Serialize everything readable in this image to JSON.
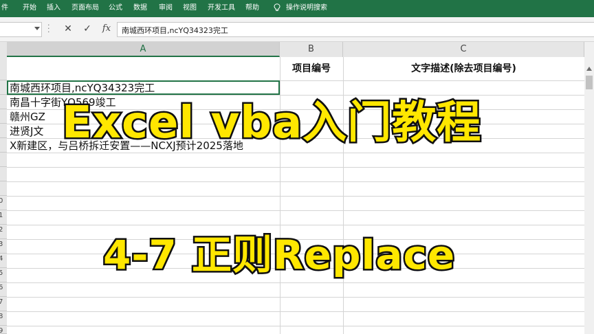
{
  "ribbon": {
    "tabs": [
      "件",
      "开始",
      "插入",
      "页面布局",
      "公式",
      "数据",
      "审阅",
      "视图",
      "开发工具",
      "帮助"
    ],
    "tell_me": "操作说明搜索",
    "bulb_icon": "lightbulb-icon",
    "color": "#217346"
  },
  "formula_bar": {
    "name_box": "",
    "cancel_icon": "✕",
    "enter_icon": "✓",
    "fx_label": "fx",
    "content": "南城西环项目,ncYQ34323完工"
  },
  "columns": [
    "A",
    "B",
    "C"
  ],
  "row_labels": [
    "",
    "",
    "",
    "",
    "",
    "",
    "",
    "",
    "",
    "0",
    "1",
    "2",
    "3",
    "4",
    "5",
    "6",
    "7",
    "8",
    "9"
  ],
  "table": {
    "headers": [
      "",
      "项目编号",
      "文字描述(除去项目编号)"
    ],
    "rows": [
      [
        "南城西环项目,ncYQ34323完工",
        "",
        ""
      ],
      [
        "南昌十字街YQ569竣工",
        "",
        ""
      ],
      [
        "赣州GZ",
        "",
        ""
      ],
      [
        "进贤J文",
        "",
        ""
      ],
      [
        "X新建区，与吕桥拆迁安置——NCXJ预计2025落地",
        "",
        ""
      ]
    ]
  },
  "overlay": {
    "title": "Excel vba入门教程",
    "subtitle": "4-7 正则Replace",
    "text_color": "#ffe700",
    "outline_color": "#111111"
  }
}
